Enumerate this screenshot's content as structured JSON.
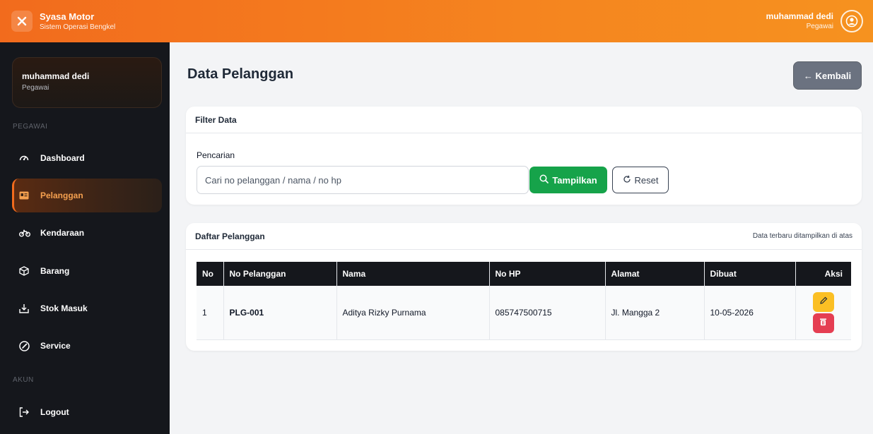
{
  "app": {
    "name": "Syasa Motor",
    "subtitle": "Sistem Operasi Bengkel"
  },
  "header_user": {
    "name": "muhammad dedi",
    "role": "Pegawai"
  },
  "sidebar": {
    "profile": {
      "name": "muhammad dedi",
      "role": "Pegawai"
    },
    "section_pegawai": "PEGAWAI",
    "section_akun": "AKUN",
    "items": [
      {
        "label": "Dashboard",
        "icon": "dashboard-icon",
        "active": false
      },
      {
        "label": "Pelanggan",
        "icon": "id-card-icon",
        "active": true
      },
      {
        "label": "Kendaraan",
        "icon": "motorcycle-icon",
        "active": false
      },
      {
        "label": "Barang",
        "icon": "box-icon",
        "active": false
      },
      {
        "label": "Stok Masuk",
        "icon": "inbox-icon",
        "active": false
      },
      {
        "label": "Service",
        "icon": "service-icon",
        "active": false
      }
    ],
    "logout_label": "Logout"
  },
  "page": {
    "title": "Data Pelanggan",
    "back_label": "← Kembali"
  },
  "filter": {
    "title": "Filter Data",
    "field_label": "Pencarian",
    "placeholder": "Cari no pelanggan / nama / no hp",
    "show_label": "Tampilkan",
    "reset_label": "Reset"
  },
  "list": {
    "title": "Daftar Pelanggan",
    "note": "Data terbaru ditampilkan di atas",
    "columns": [
      "No",
      "No Pelanggan",
      "Nama",
      "No HP",
      "Alamat",
      "Dibuat",
      "Aksi"
    ],
    "rows": [
      {
        "no": "1",
        "code": "PLG-001",
        "name": "Aditya Rizky Purnama",
        "phone": "085747500715",
        "address": "Jl. Mangga 2",
        "created": "10-05-2026"
      }
    ]
  },
  "colors": {
    "accent": "#f26b1d",
    "sidebar_bg": "#15171c",
    "success": "#16a34a",
    "warning": "#fbbf24",
    "danger": "#e53e52"
  }
}
